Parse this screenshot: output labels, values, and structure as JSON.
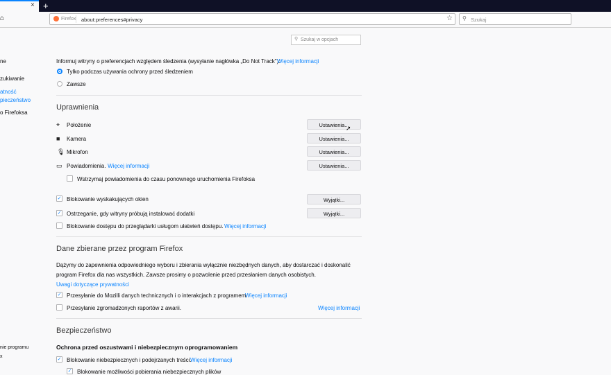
{
  "browser": {
    "tab_close": "×",
    "new_tab": "+",
    "url_identity": "Firefox",
    "url": "about:preferences#privacy",
    "search_placeholder": "Szukaj"
  },
  "pref_search": {
    "placeholder": "Szukaj w opcjach"
  },
  "sidebar": {
    "items": [
      {
        "label": "ne"
      },
      {
        "label": "zukiwanie"
      },
      {
        "label": "atność"
      },
      {
        "label": "pieczeństwo"
      },
      {
        "label": "o Firefoksa"
      },
      {
        "label": "nie programu"
      },
      {
        "label": "x"
      }
    ]
  },
  "dnt": {
    "text": "Informuj witryny o preferencjach względem śledzenia (wysyłanie nagłówka „Do Not Track\"):",
    "link": "Więcej informacji",
    "options": [
      {
        "label": "Tylko podczas używania ochrony przed śledzeniem",
        "selected": true
      },
      {
        "label": "Zawsze",
        "selected": false
      }
    ]
  },
  "permissions": {
    "heading": "Uprawnienia",
    "items": [
      {
        "icon": "location-icon",
        "label": "Położenie",
        "button": "Ustawienia..."
      },
      {
        "icon": "camera-icon",
        "label": "Kamera",
        "button": "Ustawienia..."
      },
      {
        "icon": "microphone-icon",
        "label": "Mikrofon",
        "button": "Ustawienia..."
      },
      {
        "icon": "notification-icon",
        "label": "Powiadomienia.",
        "link": "Więcej informacji",
        "button": "Ustawienia..."
      }
    ],
    "pause_notifications": {
      "label": "Wstrzymaj powiadomienia do czasu ponownego uruchomienia Firefoksa",
      "checked": false
    },
    "block_popups": {
      "label": "Blokowanie wyskakujących okien",
      "checked": true,
      "button": "Wyjątki..."
    },
    "warn_addons": {
      "label": "Ostrzeganie, gdy witryny próbują instalować dodatki",
      "checked": true,
      "button": "Wyjątki..."
    },
    "block_a11y": {
      "label": "Blokowanie dostępu do przeglądarki usługom ułatwień dostępu.",
      "link": "Więcej informacji",
      "checked": false
    }
  },
  "data_collection": {
    "heading": "Dane zbierane przez program Firefox",
    "paragraph_line1": "Dążymy do zapewnienia odpowiedniego wyboru i zbierania wyłącznie niezbędnych danych, aby dostarczać i doskonalić",
    "paragraph_line2": "program Firefox dla nas wszystkich. Zawsze prosimy o pozwolenie przed przesłaniem danych osobistych.",
    "privacy_link": "Uwagi dotyczące prywatności",
    "telemetry": {
      "label": "Przesyłanie do Mozilli danych technicznych i o interakcjach z programem.",
      "link": "Więcej informacji",
      "checked": true
    },
    "crash_reports": {
      "label": "Przesyłanie zgromadzonych raportów z awarii.",
      "link": "Więcej informacji",
      "checked": false
    }
  },
  "security": {
    "heading": "Bezpieczeństwo",
    "subheading": "Ochrona przed oszustwami i niebezpiecznym oprogramowaniem",
    "block_dangerous": {
      "label": "Blokowanie niebezpiecznych i podejrzanych treści.",
      "link": "Więcej informacji",
      "checked": true
    },
    "block_downloads": {
      "label": "Blokowanie możliwości pobierania niebezpiecznych plików",
      "checked": true
    }
  },
  "colors": {
    "accent": "#0a84ff",
    "tabstrip": "#0f1126",
    "background": "#f9f9fa"
  }
}
